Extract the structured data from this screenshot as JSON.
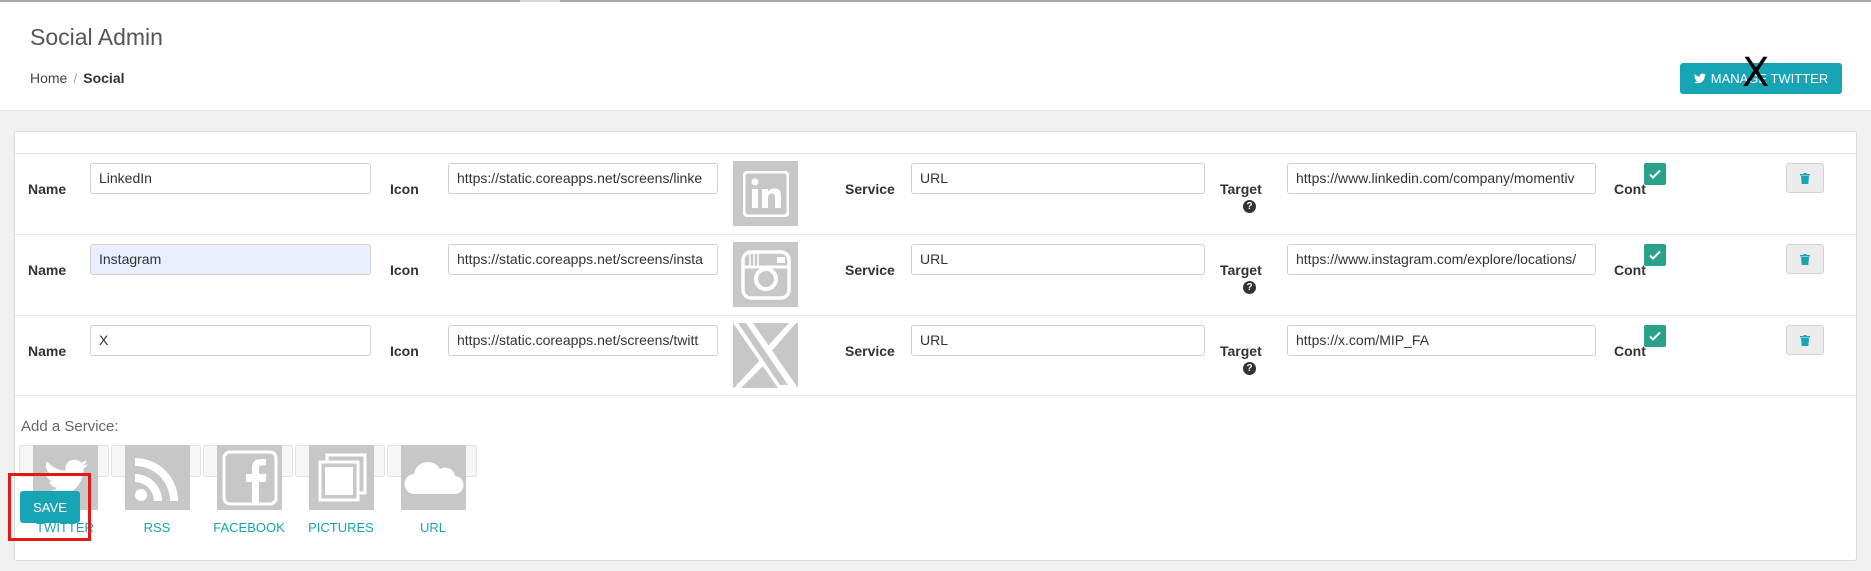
{
  "header": {
    "title": "Social Admin",
    "breadcrumb": {
      "home": "Home",
      "separator": "/",
      "current": "Social"
    },
    "manage_button": {
      "label": "MANAGE TWITTER",
      "icon": "twitter-icon",
      "overlay_glyph": "X"
    }
  },
  "labels": {
    "name": "Name",
    "icon": "Icon",
    "service": "Service",
    "target": "Target",
    "cont": "Cont"
  },
  "rows": [
    {
      "name": "LinkedIn",
      "icon_url": "https://static.coreapps.net/screens/linke",
      "service_icon": "linkedin-icon",
      "service": "URL",
      "target": "https://www.linkedin.com/company/momentiv",
      "checked": true
    },
    {
      "name": "Instagram",
      "icon_url": "https://static.coreapps.net/screens/insta",
      "service_icon": "instagram-icon",
      "service": "URL",
      "target": "https://www.instagram.com/explore/locations/",
      "checked": true
    },
    {
      "name": "X",
      "icon_url": "https://static.coreapps.net/screens/twitt",
      "service_icon": "x-logo-icon",
      "service": "URL",
      "target": "https://x.com/MIP_FA",
      "checked": true
    }
  ],
  "add_service": {
    "label": "Add a Service:",
    "services": [
      {
        "name": "TWITTER",
        "icon": "twitter-icon"
      },
      {
        "name": "RSS",
        "icon": "rss-icon"
      },
      {
        "name": "FACEBOOK",
        "icon": "facebook-icon"
      },
      {
        "name": "PICTURES",
        "icon": "pictures-icon"
      },
      {
        "name": "URL",
        "icon": "cloud-icon"
      }
    ]
  },
  "save_label": "SAVE",
  "colors": {
    "accent": "#17a4b5",
    "check": "#2aa28a",
    "icon_bg": "#c7c7c7",
    "highlight": "#e01818"
  }
}
